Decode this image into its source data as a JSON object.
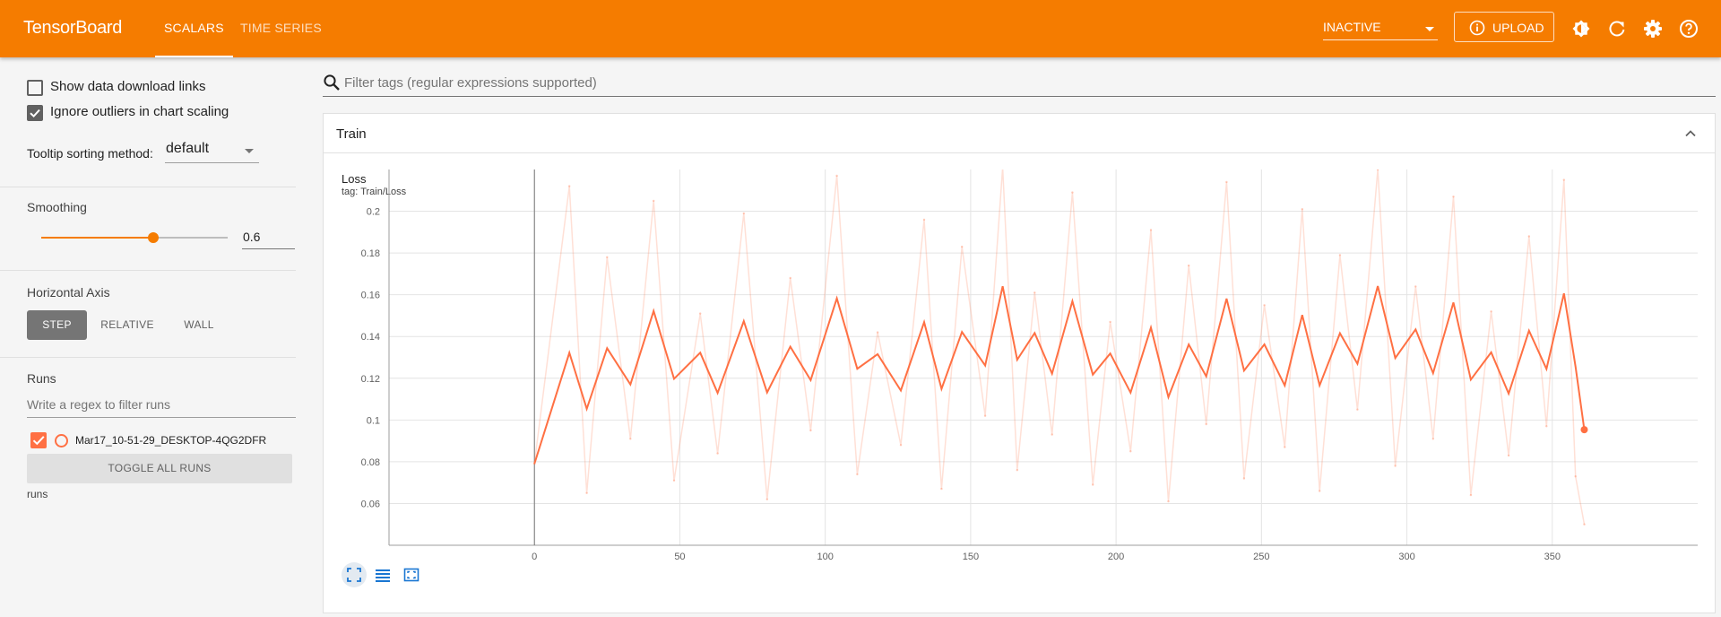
{
  "app": {
    "title": "TensorBoard",
    "tabs": [
      {
        "label": "SCALARS",
        "active": true
      },
      {
        "label": "TIME SERIES",
        "active": false
      }
    ],
    "run_status": "INACTIVE",
    "upload_label": "UPLOAD",
    "icons": [
      "brightness-icon",
      "refresh-icon",
      "settings-icon",
      "help-icon"
    ],
    "colors": {
      "header": "#f57c00",
      "accent": "#f57c00",
      "series": "#ff7043"
    }
  },
  "sidebar": {
    "show_download_links": {
      "label": "Show data download links",
      "checked": false
    },
    "ignore_outliers": {
      "label": "Ignore outliers in chart scaling",
      "checked": true
    },
    "tooltip_sorting": {
      "label": "Tooltip sorting method:",
      "value": "default"
    },
    "smoothing": {
      "title": "Smoothing",
      "value": "0.6",
      "level": 0.6
    },
    "horizontal_axis": {
      "title": "Horizontal Axis",
      "options": [
        "STEP",
        "RELATIVE",
        "WALL"
      ],
      "selected": "STEP"
    },
    "runs": {
      "title": "Runs",
      "filter_placeholder": "Write a regex to filter runs",
      "items": [
        {
          "name": "Mar17_10-51-29_DESKTOP-4QG2DFR",
          "checked": true
        }
      ],
      "toggle_label": "TOGGLE ALL RUNS",
      "footer": "runs"
    }
  },
  "main": {
    "filter_placeholder": "Filter tags (regular expressions supported)",
    "card": {
      "title": "Train",
      "chart": {
        "title": "Loss",
        "tag": "tag: Train/Loss"
      }
    }
  },
  "chart_data": {
    "type": "line",
    "title": "Loss",
    "subtitle": "tag: Train/Loss",
    "xlabel": "",
    "ylabel": "",
    "x_ticks": [
      0,
      50,
      100,
      150,
      200,
      250,
      300,
      350
    ],
    "y_ticks": [
      0.06,
      0.08,
      0.1,
      0.12,
      0.14,
      0.16,
      0.18,
      0.2
    ],
    "xlim": [
      -50,
      400
    ],
    "ylim": [
      0.04,
      0.22
    ],
    "grid": true,
    "series": [
      {
        "values": [
          [
            0,
            0.079
          ],
          [
            12,
            0.212
          ],
          [
            18,
            0.065
          ],
          [
            25,
            0.178
          ],
          [
            33,
            0.091
          ],
          [
            41,
            0.205
          ],
          [
            48,
            0.071
          ],
          [
            57,
            0.151
          ],
          [
            63,
            0.084
          ],
          [
            72,
            0.199
          ],
          [
            80,
            0.062
          ],
          [
            88,
            0.168
          ],
          [
            95,
            0.095
          ],
          [
            104,
            0.217
          ],
          [
            111,
            0.074
          ],
          [
            118,
            0.142
          ],
          [
            126,
            0.088
          ],
          [
            134,
            0.196
          ],
          [
            140,
            0.067
          ],
          [
            147,
            0.183
          ],
          [
            155,
            0.102
          ],
          [
            161,
            0.221
          ],
          [
            166,
            0.076
          ],
          [
            172,
            0.161
          ],
          [
            178,
            0.093
          ],
          [
            185,
            0.209
          ],
          [
            192,
            0.069
          ],
          [
            198,
            0.147
          ],
          [
            205,
            0.085
          ],
          [
            212,
            0.191
          ],
          [
            218,
            0.061
          ],
          [
            225,
            0.174
          ],
          [
            231,
            0.098
          ],
          [
            238,
            0.214
          ],
          [
            244,
            0.072
          ],
          [
            251,
            0.155
          ],
          [
            258,
            0.087
          ],
          [
            264,
            0.201
          ],
          [
            270,
            0.066
          ],
          [
            277,
            0.179
          ],
          [
            283,
            0.105
          ],
          [
            290,
            0.22
          ],
          [
            296,
            0.078
          ],
          [
            303,
            0.164
          ],
          [
            309,
            0.091
          ],
          [
            316,
            0.207
          ],
          [
            322,
            0.064
          ],
          [
            329,
            0.152
          ],
          [
            335,
            0.083
          ],
          [
            342,
            0.188
          ],
          [
            348,
            0.097
          ],
          [
            354,
            0.215
          ],
          [
            358,
            0.073
          ],
          [
            361,
            0.05
          ]
        ]
      }
    ]
  }
}
